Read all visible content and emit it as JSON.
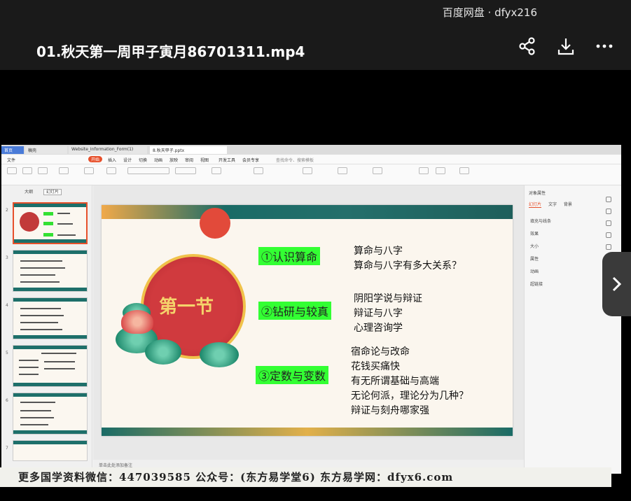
{
  "header": {
    "watermark": "百度网盘 · dfyx216",
    "video_title": "01.秋天第一周甲子寅月86701311.mp4"
  },
  "browser_tabs": [
    "首页",
    "稿壳",
    "Website_Information_Form(1)",
    "8.秋天甲子.pptx"
  ],
  "ribbon": {
    "menu": [
      "文件",
      "开始",
      "插入",
      "设计",
      "切换",
      "动画",
      "放映",
      "审阅",
      "视图",
      "开发工具",
      "会员专享"
    ],
    "active": "开始",
    "search": "查找命令、搜索模板"
  },
  "thumb_pane": {
    "tabs": [
      "大纲",
      "幻灯片"
    ],
    "numbers": [
      "2",
      "3",
      "4",
      "5",
      "6",
      "7"
    ]
  },
  "slide": {
    "circle_title": "第一节",
    "sections": [
      {
        "label": "①认识算命",
        "items": [
          "算命与八字",
          "算命与八字有多大关系？"
        ]
      },
      {
        "label": "②钻研与较真",
        "items": [
          "阴阳学说与辩证",
          "辩证与八字",
          "心理咨询学"
        ]
      },
      {
        "label": "③定数与变数",
        "items": [
          "宿命论与改命",
          "花钱买痛快",
          "有无所谓基础与高端",
          "无论何派，理论分为几种？",
          "辩证与刻舟哪家强"
        ]
      }
    ]
  },
  "right_pane": {
    "title": "对象属性",
    "tabs": [
      "幻灯片",
      "文字",
      "背景"
    ],
    "items": [
      "填充与线条",
      "效果",
      "大小",
      "属性",
      "动画",
      "超链接"
    ]
  },
  "status_text": "单击此处添加备注",
  "banner_text": "更多国学资料微信：447039585 公众号：(东方易学堂6) 东方易学网：dfyx6.com"
}
